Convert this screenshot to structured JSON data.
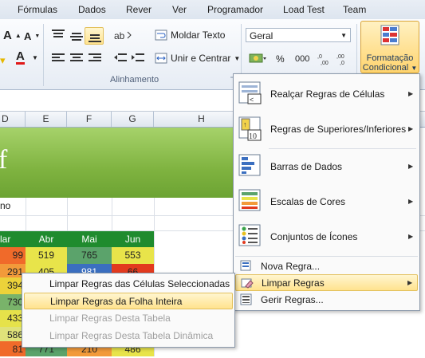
{
  "tabs": [
    "Fórmulas",
    "Dados",
    "Rever",
    "Ver",
    "Programador",
    "Load Test",
    "Team"
  ],
  "ribbon": {
    "moldar_texto": "Moldar Texto",
    "unir_centrar": "Unir e Centrar",
    "alinhamento_label": "Alinhamento",
    "number_format": "Geral",
    "percent": "%",
    "thousands": "000",
    "formatacao_line1": "Formatação",
    "formatacao_line2": "Condicional"
  },
  "columns": [
    "D",
    "E",
    "F",
    "G",
    "H"
  ],
  "sheet": {
    "banner_text": "f",
    "row_label": "no",
    "month_headers": [
      "lar",
      "Abr",
      "Mai",
      "Jun"
    ],
    "rows": [
      [
        "99",
        "519",
        "765",
        "553"
      ],
      [
        "291",
        "405",
        "981",
        "66"
      ],
      [
        "394",
        "",
        "",
        ""
      ],
      [
        "730",
        "",
        "",
        ""
      ],
      [
        "433",
        "",
        "",
        ""
      ],
      [
        "586",
        "",
        "",
        ""
      ],
      [
        "81",
        "771",
        "210",
        "486"
      ]
    ]
  },
  "cf_menu": {
    "items": [
      {
        "label": "Realçar Regras de Células",
        "icon": "highlight-cells-icon"
      },
      {
        "label": "Regras de Superiores/Inferiores",
        "icon": "top-bottom-icon"
      },
      {
        "label": "Barras de Dados",
        "icon": "data-bars-icon"
      },
      {
        "label": "Escalas de Cores",
        "icon": "color-scales-icon"
      },
      {
        "label": "Conjuntos de Ícones",
        "icon": "icon-sets-icon"
      }
    ],
    "nova_regra": "Nova Regra...",
    "limpar_regras": "Limpar Regras",
    "gerir_regras": "Gerir Regras..."
  },
  "clear_menu": {
    "items": [
      {
        "label": "Limpar Regras das Células Seleccionadas",
        "enabled": true
      },
      {
        "label": "Limpar Regras da Folha Inteira",
        "enabled": true
      },
      {
        "label": "Limpar Regras Desta Tabela",
        "enabled": false
      },
      {
        "label": "Limpar Regras Desta Tabela Dinâmica",
        "enabled": false
      }
    ]
  }
}
